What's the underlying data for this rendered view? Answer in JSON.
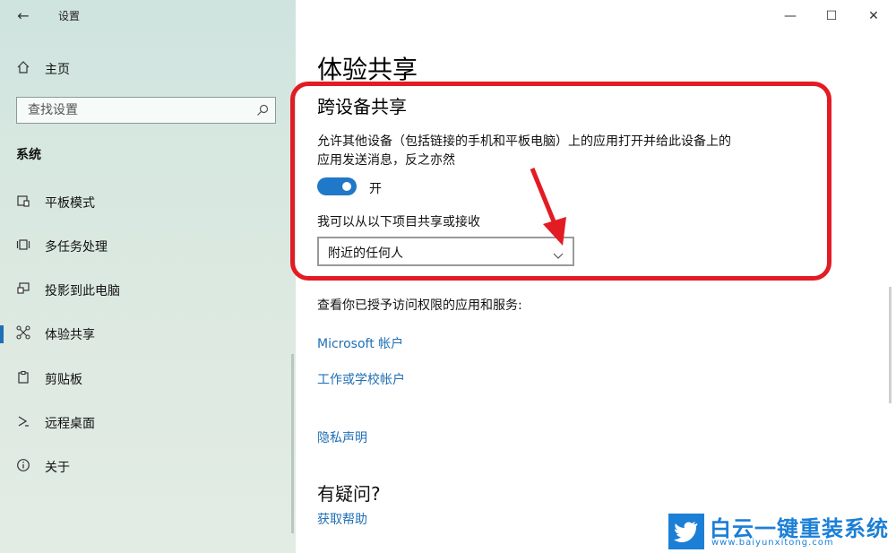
{
  "window": {
    "app_title": "设置",
    "controls": {
      "minimize": "—",
      "maximize": "☐",
      "close": "✕"
    }
  },
  "sidebar": {
    "home_label": "主页",
    "search_placeholder": "查找设置",
    "section": "系统",
    "items": [
      {
        "label": "平板模式",
        "icon": "tablet-mode-icon",
        "active": false
      },
      {
        "label": "多任务处理",
        "icon": "multitasking-icon",
        "active": false
      },
      {
        "label": "投影到此电脑",
        "icon": "project-to-pc-icon",
        "active": false
      },
      {
        "label": "体验共享",
        "icon": "shared-experiences-icon",
        "active": true
      },
      {
        "label": "剪贴板",
        "icon": "clipboard-icon",
        "active": false
      },
      {
        "label": "远程桌面",
        "icon": "remote-desktop-icon",
        "active": false
      },
      {
        "label": "关于",
        "icon": "info-icon",
        "active": false
      }
    ]
  },
  "main": {
    "page_title": "体验共享",
    "section_title": "跨设备共享",
    "description": "允许其他设备（包括链接的手机和平板电脑）上的应用打开并给此设备上的应用发送消息，反之亦然",
    "toggle": {
      "state": "on",
      "label": "开"
    },
    "share_label": "我可以从以下项目共享或接收",
    "dropdown_value": "附近的任何人",
    "permissions_text": "查看你已授予访问权限的应用和服务:",
    "links": {
      "microsoft": "Microsoft 帐户",
      "work_school": "工作或学校帐户",
      "privacy": "隐私声明",
      "help": "获取帮助"
    },
    "question": "有疑问?"
  },
  "watermark": {
    "brand": "白云一键重装系统",
    "url": "www.baiyunxitong.com"
  },
  "colors": {
    "accent": "#1f78c8",
    "link": "#1f6fb5",
    "highlight": "#e31b23"
  }
}
